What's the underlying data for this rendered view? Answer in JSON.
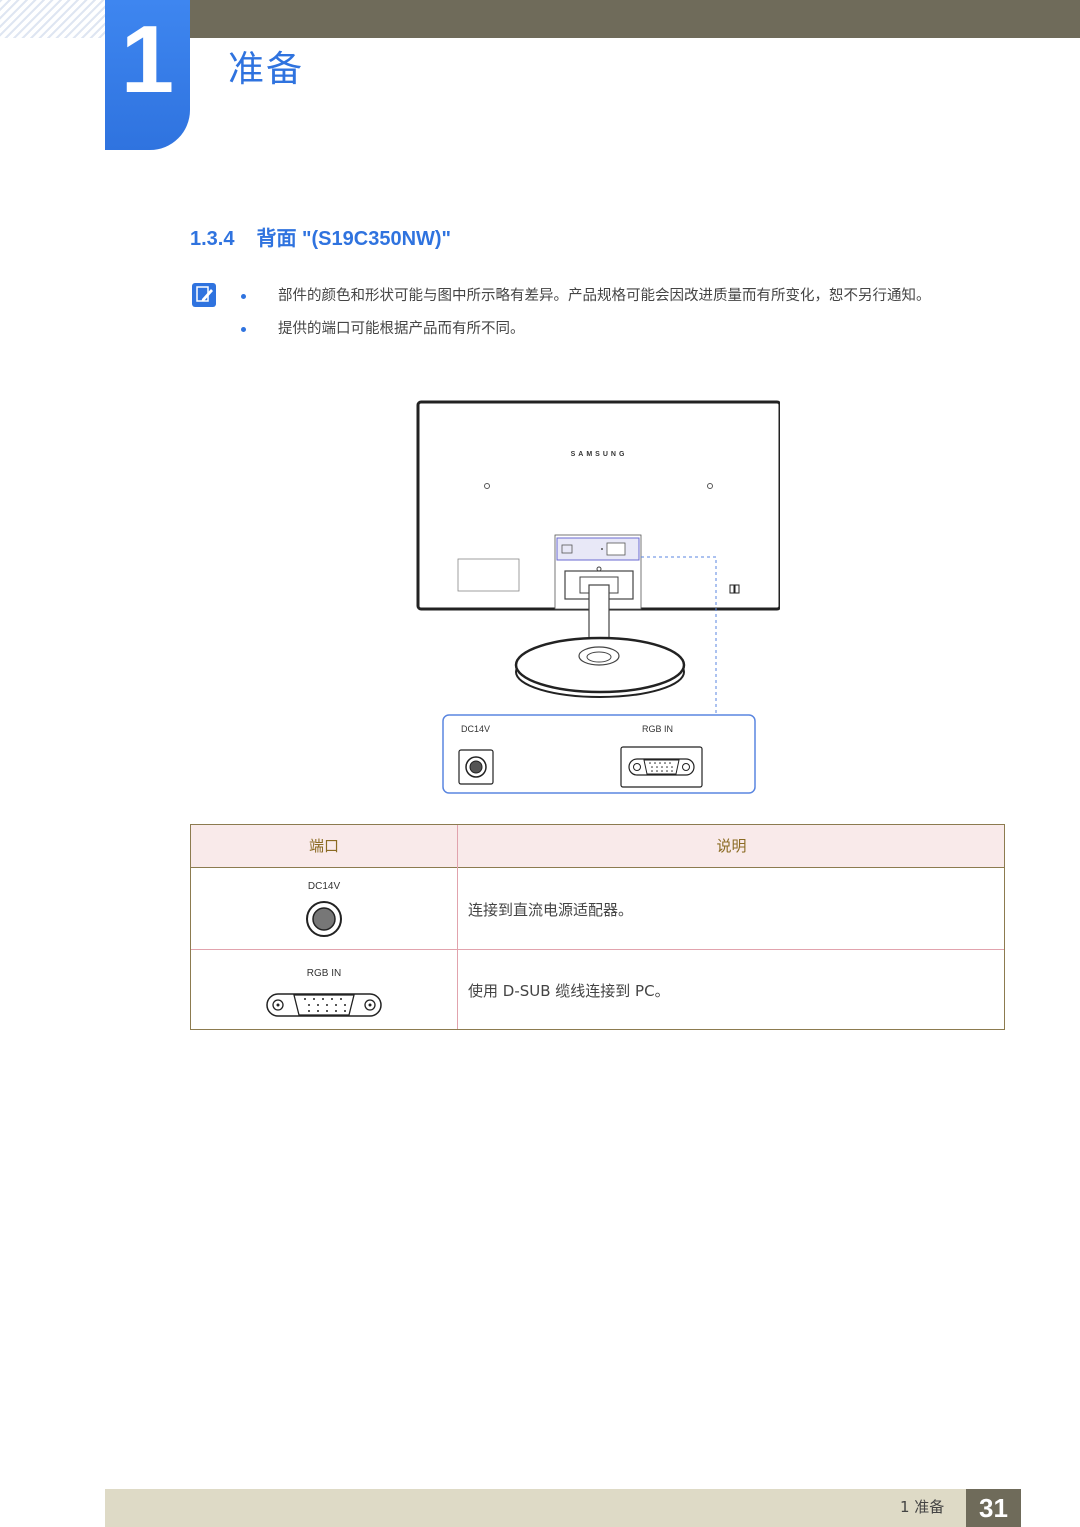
{
  "header": {
    "chapter_number": "1",
    "chapter_title": "准备"
  },
  "section": {
    "number": "1.3.4",
    "title": "背面 \"(S19C350NW)\""
  },
  "notes": [
    "部件的颜色和形状可能与图中所示略有差异。产品规格可能会因改进质量而有所变化，恕不另行通知。",
    "提供的端口可能根据产品而有所不同。"
  ],
  "figure": {
    "brand_text": "SAMSUNG",
    "callout_port_1": "DC14V",
    "callout_port_2": "RGB IN"
  },
  "table": {
    "headers": [
      "端口",
      "说明"
    ],
    "rows": [
      {
        "port_label": "DC14V",
        "description": "连接到直流电源适配器。"
      },
      {
        "port_label": "RGB IN",
        "description": "使用 D-SUB 缆线连接到 PC。"
      }
    ]
  },
  "footer": {
    "chapter_label": "1 准备",
    "page_number": "31"
  },
  "colors": {
    "accent_blue": "#2f73df",
    "bar_olive": "#6f6b5a",
    "table_border": "#8c7b4f",
    "table_header_bg": "#f9eaea",
    "table_header_text": "#8b6b23"
  }
}
